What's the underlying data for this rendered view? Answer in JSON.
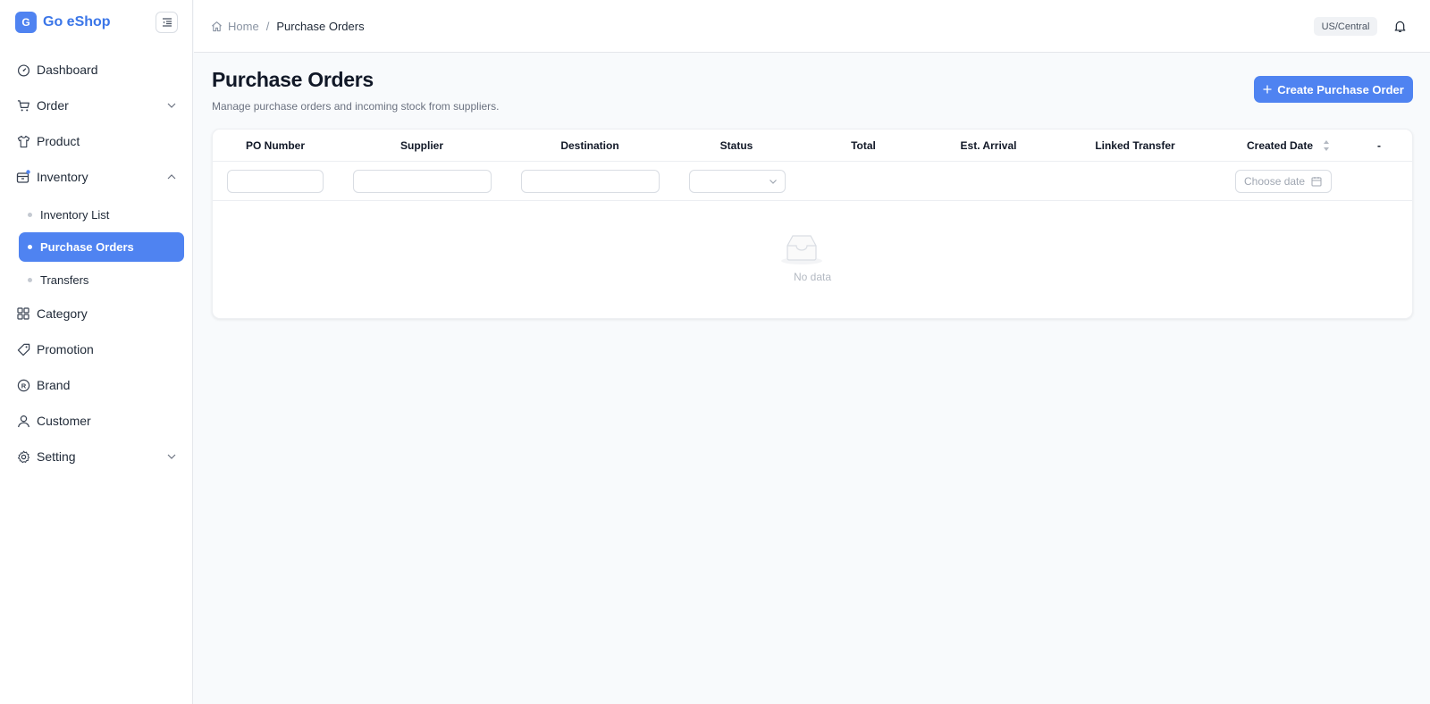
{
  "app": {
    "logo_letter": "G",
    "name": "Go eShop"
  },
  "sidebar": {
    "items": [
      {
        "label": "Dashboard"
      },
      {
        "label": "Order"
      },
      {
        "label": "Product"
      },
      {
        "label": "Inventory"
      },
      {
        "label": "Category"
      },
      {
        "label": "Promotion"
      },
      {
        "label": "Brand"
      },
      {
        "label": "Customer"
      },
      {
        "label": "Setting"
      }
    ],
    "inventory_sub": [
      {
        "label": "Inventory List"
      },
      {
        "label": "Purchase Orders",
        "active": true
      },
      {
        "label": "Transfers"
      }
    ]
  },
  "header": {
    "breadcrumb": {
      "home": "Home",
      "separator": "/",
      "current": "Purchase Orders"
    },
    "timezone": "US/Central"
  },
  "main": {
    "title": "Purchase Orders",
    "subtitle": "Manage purchase orders and incoming stock from suppliers.",
    "create_button": "Create Purchase Order"
  },
  "table": {
    "columns": [
      "PO Number",
      "Supplier",
      "Destination",
      "Status",
      "Total",
      "Est. Arrival",
      "Linked Transfer",
      "Created Date",
      "-"
    ],
    "date_placeholder": "Choose date",
    "empty_text": "No data"
  },
  "colors": {
    "accent": "#4f83f1",
    "brand_text": "#3b76e8"
  }
}
